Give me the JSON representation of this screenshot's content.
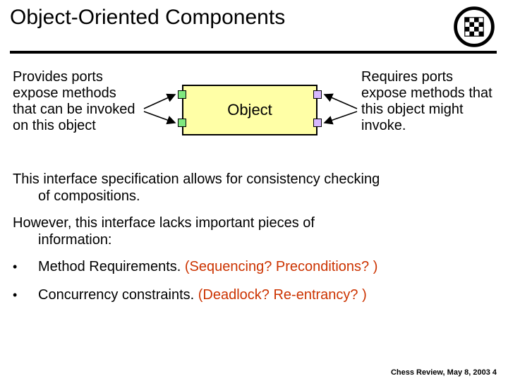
{
  "title": "Object-Oriented Components",
  "diagram": {
    "provides_text": "Provides ports expose methods that can be invoked on this object",
    "object_label": "Object",
    "requires_text": "Requires ports expose methods that this object might invoke."
  },
  "para1_line1": "This interface specification allows for consistency checking",
  "para1_line2": "of compositions.",
  "para2_line1": "However, this interface lacks important pieces of",
  "para2_line2": "information:",
  "bullets": [
    {
      "black": "Method Requirements. ",
      "red": "(Sequencing? Preconditions? )"
    },
    {
      "black": "Concurrency constraints. ",
      "red": "(Deadlock? Re-entrancy? )"
    }
  ],
  "footer": "Chess Review, May 8, 2003 4"
}
